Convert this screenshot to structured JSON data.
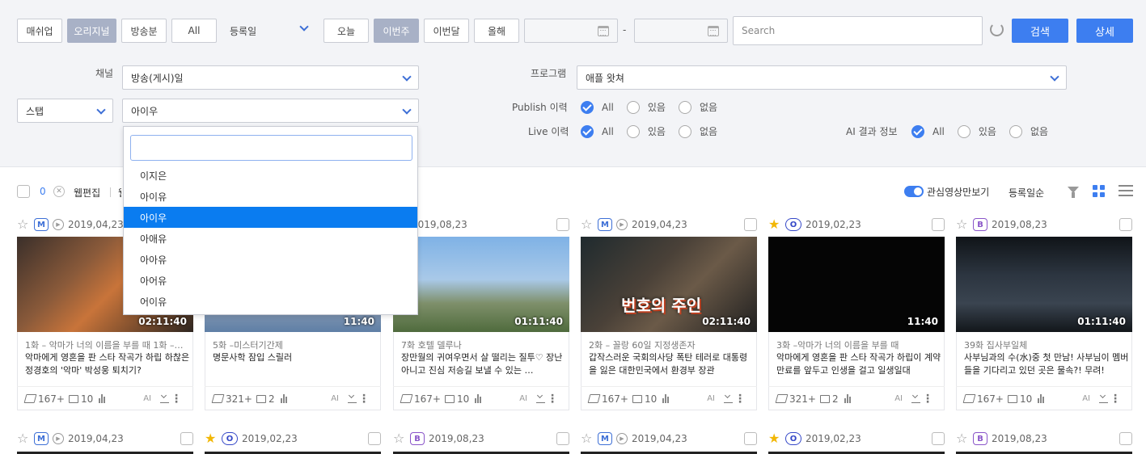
{
  "filters": {
    "type_buttons": [
      "매쉬업",
      "오리지널",
      "방송분",
      "All"
    ],
    "date_type": "등록일",
    "period_buttons": [
      "오늘",
      "이번주",
      "이번달",
      "올해"
    ],
    "date_separator": "-",
    "search_placeholder": "Search",
    "search_button": "검색",
    "detail_button": "상세",
    "channel_label": "채널",
    "channel_value": "방송(게시)일",
    "program_label": "프로그램",
    "program_value": "애플 왓쳐",
    "staff_select": "스탭",
    "staff_value": "아이우",
    "publish_label": "Publish 이력",
    "live_label": "Live 이력",
    "ai_label": "AI 결과 정보",
    "radio_options": [
      "All",
      "있음",
      "없음"
    ]
  },
  "dropdown": {
    "search_value": "",
    "items": [
      "이지은",
      "아이유",
      "아이우",
      "아애유",
      "아아유",
      "아어유",
      "어이유"
    ],
    "selected_index": 2
  },
  "toolbar": {
    "selected_count": "0",
    "edit_label": "웹편집",
    "edit_label_partial": "웹",
    "interest_toggle_label": "관심영상만보기",
    "sort_label": "등록일순"
  },
  "colors": {
    "accent": "#3d7ef0",
    "active_filter": "#a8b1c6",
    "selected_item": "#0a7cf0",
    "star_favorite": "#f2b705"
  },
  "cards": [
    {
      "star": false,
      "badge": "M",
      "replay": true,
      "date": "2019,04,23",
      "duration": "02:11:40",
      "episode": "1화 – 악마가 너의 이름을 부를 때 1화 –…",
      "desc": "악마에게 영혼을 판 스타 작곡가 하립 하찮은 정경호의 '악마' 박성웅 퇴치기?",
      "shares": "167+",
      "clips": "10",
      "ai": "AI"
    },
    {
      "star": false,
      "badge": "",
      "replay": false,
      "date": "",
      "duration": "11:40",
      "episode": "5화 –미스터기간제",
      "desc": "명문사학 잠입 스릴러",
      "shares": "321+",
      "clips": "2",
      "ai": "AI"
    },
    {
      "star": false,
      "badge": "",
      "replay": false,
      "date": "2019,08,23",
      "duration": "01:11:40",
      "episode": "7화 호텔 델루나",
      "desc": "장만월의 귀여우면서 살 떨리는 질투♡ 장난아니고 진심 저승길 보낼 수 있는 …",
      "shares": "167+",
      "clips": "10",
      "ai": "AI"
    },
    {
      "star": false,
      "badge": "M",
      "replay": true,
      "date": "2019,04,23",
      "duration": "02:11:40",
      "episode": "2화 – 꼴랑 60일 지정생존자",
      "desc": "갑작스러운 국회의사당 폭탄 테러로 대통령을 잃은 대한민국에서 환경부 장관",
      "shares": "167+",
      "clips": "10",
      "ai": "AI",
      "overlay": "번호의 주인"
    },
    {
      "star": true,
      "badge": "O",
      "replay": false,
      "date": "2019,02,23",
      "duration": "11:40",
      "episode": "3화 –악마가 너의 이름을 부를 때",
      "desc": "악마에게 영혼을 판 스타 작곡가 하립이 계약 만료를 앞두고 인생을 걸고 일생일대",
      "shares": "321+",
      "clips": "2",
      "ai": "AI"
    },
    {
      "star": false,
      "badge": "B",
      "replay": false,
      "date": "2019,08,23",
      "duration": "01:11:40",
      "episode": "39화 집사부일체",
      "desc": "사부님과의 수(水)중 첫 만남! 사부님이 멤버들을 기다리고 있던 곳은 물속?! 무려!",
      "shares": "167+",
      "clips": "10",
      "ai": "AI"
    }
  ],
  "cards_row2": [
    {
      "star": false,
      "badge": "M",
      "replay": true,
      "date": "2019,04,23"
    },
    {
      "star": true,
      "badge": "O",
      "replay": false,
      "date": "2019,02,23"
    },
    {
      "star": false,
      "badge": "B",
      "replay": false,
      "date": "2019,08,23"
    },
    {
      "star": false,
      "badge": "M",
      "replay": true,
      "date": "2019,04,23"
    },
    {
      "star": true,
      "badge": "O",
      "replay": false,
      "date": "2019,02,23"
    },
    {
      "star": false,
      "badge": "B",
      "replay": false,
      "date": "2019,08,23"
    }
  ]
}
